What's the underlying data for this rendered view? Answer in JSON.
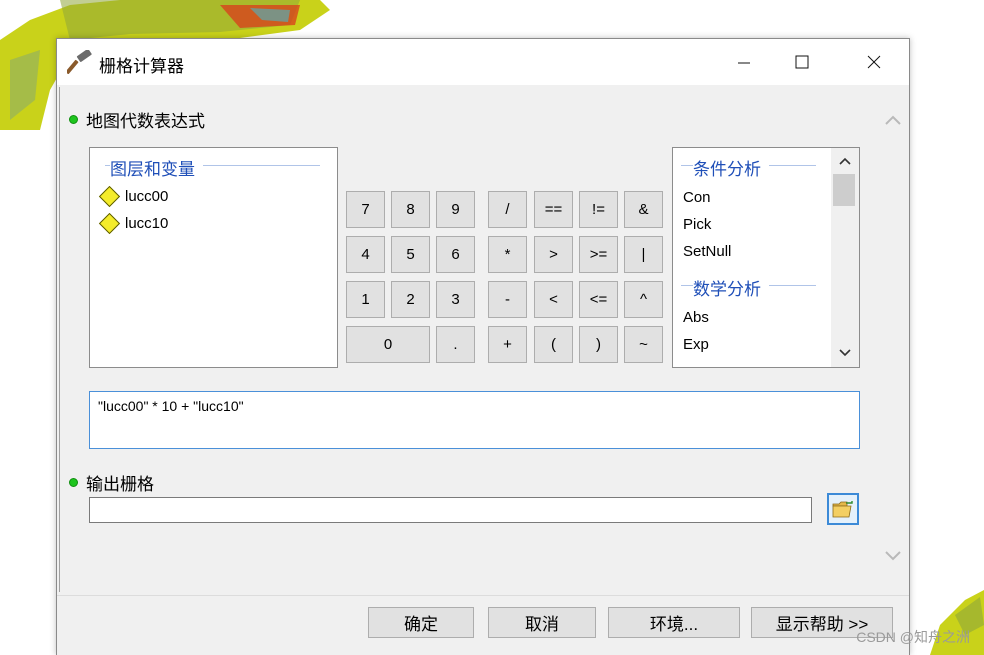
{
  "window": {
    "title": "栅格计算器"
  },
  "controls": {
    "minimize": "—",
    "maximize": "☐",
    "close": "✕"
  },
  "expression_section": {
    "label": "地图代数表达式"
  },
  "layers": {
    "title": "图层和变量",
    "items": [
      "lucc00",
      "lucc10"
    ]
  },
  "keypad": {
    "digits": [
      "7",
      "8",
      "9",
      "4",
      "5",
      "6",
      "1",
      "2",
      "3",
      "0",
      "."
    ],
    "operators": [
      "/",
      "==",
      "!=",
      "&",
      "*",
      ">",
      ">=",
      "|",
      "-",
      "<",
      "<=",
      "^",
      "+",
      "(",
      ")",
      "~"
    ]
  },
  "functions": {
    "group1_title": "条件分析",
    "group1_items": [
      "Con",
      "Pick",
      "SetNull"
    ],
    "group2_title": "数学分析",
    "group2_items": [
      "Abs",
      "Exp"
    ]
  },
  "expression": {
    "value": "\"lucc00\" * 10 + \"lucc10\""
  },
  "output_section": {
    "label": "输出栅格",
    "value": ""
  },
  "footer": {
    "ok": "确定",
    "cancel": "取消",
    "environments": "环境...",
    "show_help": "显示帮助 >>"
  },
  "watermark": "CSDN @知舟之洲",
  "colors": {
    "accent": "#1f4fb8",
    "status_dot": "#1ec41e",
    "focus_border": "#3c8ad7"
  }
}
